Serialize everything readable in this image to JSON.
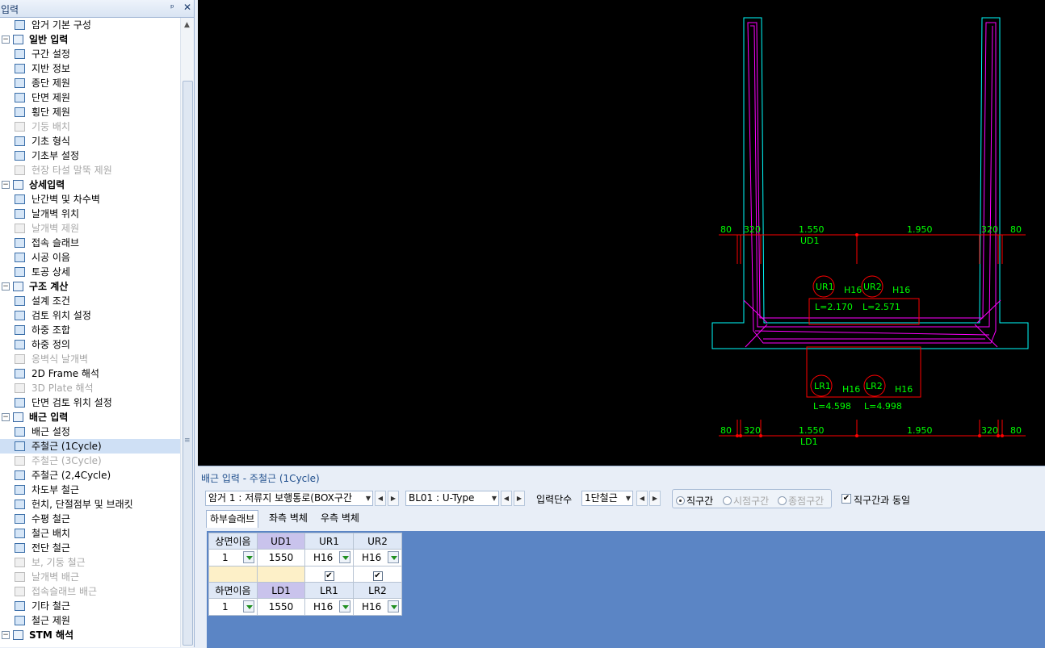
{
  "left_panel": {
    "title": "입력",
    "pin_glyph": "ᵖ",
    "close_glyph": "✕",
    "tree": [
      {
        "kind": "item",
        "label": "암거 기본 구성",
        "icon": "box-structure-icon",
        "disabled": false
      },
      {
        "kind": "group",
        "label": "일반 입력",
        "icon": "general-input-icon"
      },
      {
        "kind": "item",
        "label": "구간 설정",
        "icon": "section-setting-icon",
        "disabled": false
      },
      {
        "kind": "item",
        "label": "지반 정보",
        "icon": "ground-info-icon",
        "disabled": false
      },
      {
        "kind": "item",
        "label": "종단 제원",
        "icon": "profile-spec-icon",
        "disabled": false
      },
      {
        "kind": "item",
        "label": "단면 제원",
        "icon": "section-spec-icon",
        "disabled": false
      },
      {
        "kind": "item",
        "label": "횡단 제원",
        "icon": "cross-spec-icon",
        "disabled": false
      },
      {
        "kind": "item",
        "label": "기둥 배치",
        "icon": "column-layout-icon",
        "disabled": true
      },
      {
        "kind": "item",
        "label": "기초 형식",
        "icon": "foundation-type-icon",
        "disabled": false
      },
      {
        "kind": "item",
        "label": "기초부 설정",
        "icon": "foundation-setting-icon",
        "disabled": false
      },
      {
        "kind": "item",
        "label": "현장 타설 말뚝 제원",
        "icon": "cast-pile-icon",
        "disabled": true
      },
      {
        "kind": "group",
        "label": "상세입력",
        "icon": "detail-input-icon"
      },
      {
        "kind": "item",
        "label": "난간벽 및 차수벽",
        "icon": "parapet-icon",
        "disabled": false
      },
      {
        "kind": "item",
        "label": "날개벽 위치",
        "icon": "wingwall-position-icon",
        "disabled": false
      },
      {
        "kind": "item",
        "label": "날개벽 제원",
        "icon": "wingwall-spec-icon",
        "disabled": true
      },
      {
        "kind": "item",
        "label": "접속 슬래브",
        "icon": "approach-slab-icon",
        "disabled": false
      },
      {
        "kind": "item",
        "label": "시공 이음",
        "icon": "construction-joint-icon",
        "disabled": false
      },
      {
        "kind": "item",
        "label": "토공 상세",
        "icon": "earthwork-icon",
        "disabled": false
      },
      {
        "kind": "group",
        "label": "구조 계산",
        "icon": "structural-calc-icon"
      },
      {
        "kind": "item",
        "label": "설계 조건",
        "icon": "design-condition-icon",
        "disabled": false
      },
      {
        "kind": "item",
        "label": "검토 위치 설정",
        "icon": "check-position-icon",
        "disabled": false
      },
      {
        "kind": "item",
        "label": "하중 조합",
        "icon": "load-combination-icon",
        "disabled": false
      },
      {
        "kind": "item",
        "label": "하중 정의",
        "icon": "load-definition-icon",
        "disabled": false
      },
      {
        "kind": "item",
        "label": "옹벽식 날개벽",
        "icon": "retaining-wingwall-icon",
        "disabled": true
      },
      {
        "kind": "item",
        "label": "2D Frame 해석",
        "icon": "frame-2d-icon",
        "disabled": false
      },
      {
        "kind": "item",
        "label": "3D Plate 해석",
        "icon": "plate-3d-icon",
        "disabled": true
      },
      {
        "kind": "item",
        "label": "단면 검토 위치 설정",
        "icon": "section-check-icon",
        "disabled": false
      },
      {
        "kind": "group",
        "label": "배근 입력",
        "icon": "rebar-input-icon"
      },
      {
        "kind": "item",
        "label": "배근 설정",
        "icon": "rebar-setting-icon",
        "disabled": false
      },
      {
        "kind": "item",
        "label": "주철근 (1Cycle)",
        "icon": "main-rebar-1cycle-icon",
        "disabled": false,
        "selected": true
      },
      {
        "kind": "item",
        "label": "주철근 (3Cycle)",
        "icon": "main-rebar-3cycle-icon",
        "disabled": true
      },
      {
        "kind": "item",
        "label": "주철근 (2,4Cycle)",
        "icon": "main-rebar-24cycle-icon",
        "disabled": false
      },
      {
        "kind": "item",
        "label": "차도부 철근",
        "icon": "roadway-rebar-icon",
        "disabled": false
      },
      {
        "kind": "item",
        "label": "헌치, 단절점부 및 브래킷",
        "icon": "haunch-icon",
        "disabled": false
      },
      {
        "kind": "item",
        "label": "수평 철근",
        "icon": "horizontal-rebar-icon",
        "disabled": false
      },
      {
        "kind": "item",
        "label": "철근 배치",
        "icon": "rebar-layout-icon",
        "disabled": false
      },
      {
        "kind": "item",
        "label": "전단 철근",
        "icon": "shear-rebar-icon",
        "disabled": false
      },
      {
        "kind": "item",
        "label": "보, 기둥 철근",
        "icon": "beam-column-rebar-icon",
        "disabled": true
      },
      {
        "kind": "item",
        "label": "날개벽 배근",
        "icon": "wingwall-rebar-icon",
        "disabled": true
      },
      {
        "kind": "item",
        "label": "접속슬래브 배근",
        "icon": "approach-slab-rebar-icon",
        "disabled": true
      },
      {
        "kind": "item",
        "label": "기타 철근",
        "icon": "other-rebar-icon",
        "disabled": false
      },
      {
        "kind": "item",
        "label": "철근 제원",
        "icon": "rebar-spec-icon",
        "disabled": false
      },
      {
        "kind": "group",
        "label": "STM 해석",
        "icon": "stm-analysis-icon"
      }
    ]
  },
  "drawing": {
    "colors": {
      "background": "#000000",
      "outline": "#00ffff",
      "rebar": "#ff00ff",
      "dimension": "#ff0000",
      "text": "#00ff00"
    },
    "top_dimensions": [
      "80",
      "320",
      "1.550",
      "1.950",
      "320",
      "80"
    ],
    "top_line_label": "UD1",
    "bottom_dimensions": [
      "80",
      "320",
      "1.550",
      "1.950",
      "320",
      "80"
    ],
    "bottom_line_label": "LD1",
    "upper_callouts": [
      {
        "circle": "UR1",
        "size": "H16",
        "length": "L=2.170"
      },
      {
        "circle": "UR2",
        "size": "H16",
        "length": "L=2.571"
      }
    ],
    "lower_callouts": [
      {
        "circle": "LR1",
        "size": "H16",
        "length": "L=4.598"
      },
      {
        "circle": "LR2",
        "size": "H16",
        "length": "L=4.998"
      }
    ]
  },
  "bottom_panel": {
    "title": "배근 입력 - 주철근 (1Cycle)",
    "box_select": "암거 1 : 저류지 보행통로(BOX구간",
    "type_select": "BL01 : U-Type",
    "layer_label": "입력단수",
    "layer_select": "1단철근",
    "radios": [
      {
        "label": "직구간",
        "checked": true,
        "disabled": false
      },
      {
        "label": "시점구간",
        "checked": false,
        "disabled": true
      },
      {
        "label": "종점구간",
        "checked": false,
        "disabled": true
      }
    ],
    "same_as_label": "직구간과 동일",
    "same_as_checked": true,
    "tabs": [
      "하부슬래브",
      "좌측 벽체",
      "우측 벽체"
    ],
    "grid": {
      "upper_headers": [
        "상면이음",
        "UD1",
        "UR1",
        "UR2"
      ],
      "upper_values": [
        "1",
        "1550",
        "H16",
        "H16"
      ],
      "check_glyph": "✔",
      "lower_headers": [
        "하면이음",
        "LD1",
        "LR1",
        "LR2"
      ],
      "lower_values": [
        "1",
        "1550",
        "H16",
        "H16"
      ]
    }
  }
}
